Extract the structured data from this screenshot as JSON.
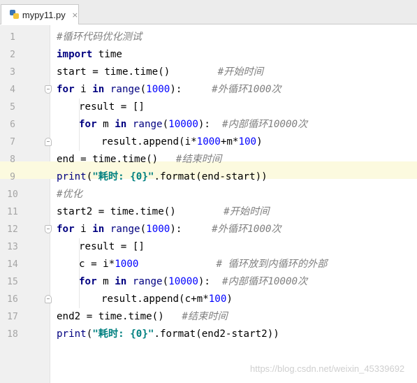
{
  "tab": {
    "filename": "mypy11.py",
    "close_glyph": "×",
    "icon": "python-file-icon"
  },
  "code_lines": [
    {
      "n": "1",
      "indent": 0,
      "parts": [
        {
          "t": "#循环代码优化测试",
          "c": "cm"
        }
      ]
    },
    {
      "n": "2",
      "indent": 0,
      "parts": [
        {
          "t": "import",
          "c": "kw"
        },
        {
          "t": " time",
          "c": "pl"
        }
      ]
    },
    {
      "n": "3",
      "indent": 0,
      "parts": [
        {
          "t": "start = time.time()        ",
          "c": "pl"
        },
        {
          "t": "#开始时间",
          "c": "cm"
        }
      ]
    },
    {
      "n": "4",
      "indent": 0,
      "parts": [
        {
          "t": "for",
          "c": "kw"
        },
        {
          "t": " i ",
          "c": "pl"
        },
        {
          "t": "in",
          "c": "kw"
        },
        {
          "t": " ",
          "c": "pl"
        },
        {
          "t": "range",
          "c": "bi"
        },
        {
          "t": "(",
          "c": "pl"
        },
        {
          "t": "1000",
          "c": "num"
        },
        {
          "t": "):     ",
          "c": "pl"
        },
        {
          "t": "#外循环1000次",
          "c": "cm"
        }
      ]
    },
    {
      "n": "5",
      "indent": 1,
      "parts": [
        {
          "t": "result = []",
          "c": "pl"
        }
      ]
    },
    {
      "n": "6",
      "indent": 1,
      "parts": [
        {
          "t": "for",
          "c": "kw"
        },
        {
          "t": " m ",
          "c": "pl"
        },
        {
          "t": "in",
          "c": "kw"
        },
        {
          "t": " ",
          "c": "pl"
        },
        {
          "t": "range",
          "c": "bi"
        },
        {
          "t": "(",
          "c": "pl"
        },
        {
          "t": "10000",
          "c": "num"
        },
        {
          "t": "):  ",
          "c": "pl"
        },
        {
          "t": "#内部循环10000次",
          "c": "cm"
        }
      ]
    },
    {
      "n": "7",
      "indent": 2,
      "parts": [
        {
          "t": "result.append(i*",
          "c": "pl"
        },
        {
          "t": "1000",
          "c": "num"
        },
        {
          "t": "+m*",
          "c": "pl"
        },
        {
          "t": "100",
          "c": "num"
        },
        {
          "t": ")",
          "c": "pl"
        }
      ]
    },
    {
      "n": "8",
      "indent": 0,
      "parts": [
        {
          "t": "end = time.time()   ",
          "c": "pl"
        },
        {
          "t": "#结束时间",
          "c": "cm"
        }
      ]
    },
    {
      "n": "9",
      "indent": 0,
      "parts": [
        {
          "t": "print",
          "c": "bi"
        },
        {
          "t": "(",
          "c": "pl"
        },
        {
          "t": "\"耗时: {0}\"",
          "c": "str"
        },
        {
          "t": ".format(end-start))",
          "c": "pl"
        }
      ]
    },
    {
      "n": "10",
      "indent": 0,
      "parts": [
        {
          "t": "#优化",
          "c": "cm"
        }
      ]
    },
    {
      "n": "11",
      "indent": 0,
      "parts": [
        {
          "t": "start2 = time.time()        ",
          "c": "pl"
        },
        {
          "t": "#开始时间",
          "c": "cm"
        }
      ]
    },
    {
      "n": "12",
      "indent": 0,
      "parts": [
        {
          "t": "for",
          "c": "kw"
        },
        {
          "t": " i ",
          "c": "pl"
        },
        {
          "t": "in",
          "c": "kw"
        },
        {
          "t": " ",
          "c": "pl"
        },
        {
          "t": "range",
          "c": "bi"
        },
        {
          "t": "(",
          "c": "pl"
        },
        {
          "t": "1000",
          "c": "num"
        },
        {
          "t": "):     ",
          "c": "pl"
        },
        {
          "t": "#外循环1000次",
          "c": "cm"
        }
      ]
    },
    {
      "n": "13",
      "indent": 1,
      "parts": [
        {
          "t": "result = []",
          "c": "pl"
        }
      ]
    },
    {
      "n": "14",
      "indent": 1,
      "parts": [
        {
          "t": "c = i*",
          "c": "pl"
        },
        {
          "t": "1000",
          "c": "num"
        },
        {
          "t": "             ",
          "c": "pl"
        },
        {
          "t": "# 循环放到内循环的外部",
          "c": "cm"
        }
      ]
    },
    {
      "n": "15",
      "indent": 1,
      "parts": [
        {
          "t": "for",
          "c": "kw"
        },
        {
          "t": " m ",
          "c": "pl"
        },
        {
          "t": "in",
          "c": "kw"
        },
        {
          "t": " ",
          "c": "pl"
        },
        {
          "t": "range",
          "c": "bi"
        },
        {
          "t": "(",
          "c": "pl"
        },
        {
          "t": "10000",
          "c": "num"
        },
        {
          "t": "):  ",
          "c": "pl"
        },
        {
          "t": "#内部循环10000次",
          "c": "cm"
        }
      ]
    },
    {
      "n": "16",
      "indent": 2,
      "parts": [
        {
          "t": "result.append(c+m*",
          "c": "pl"
        },
        {
          "t": "100",
          "c": "num"
        },
        {
          "t": ")",
          "c": "pl"
        }
      ]
    },
    {
      "n": "17",
      "indent": 0,
      "parts": [
        {
          "t": "end2 = time.time()   ",
          "c": "pl"
        },
        {
          "t": "#结束时间",
          "c": "cm"
        }
      ]
    },
    {
      "n": "18",
      "indent": 0,
      "parts": [
        {
          "t": "print",
          "c": "bi"
        },
        {
          "t": "(",
          "c": "pl"
        },
        {
          "t": "\"耗时: {0}\"",
          "c": "str"
        },
        {
          "t": ".format(end2-start2))",
          "c": "pl"
        }
      ]
    }
  ],
  "caret_line": "10",
  "fold_markers": [
    {
      "line": "4",
      "kind": "open"
    },
    {
      "line": "7",
      "kind": "close"
    },
    {
      "line": "12",
      "kind": "open"
    },
    {
      "line": "16",
      "kind": "close"
    }
  ],
  "watermark": "https://blog.csdn.net/weixin_45339692",
  "colors": {
    "keyword": "#000080",
    "number": "#0000ff",
    "string": "#008080",
    "comment": "#808080",
    "caret_line_bg": "#fcfadf",
    "gutter_bg": "#f0f0f0"
  }
}
